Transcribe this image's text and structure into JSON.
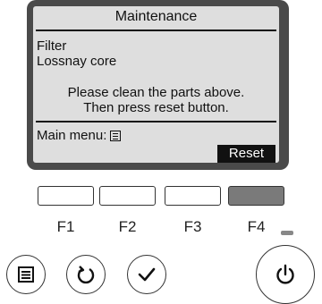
{
  "screen": {
    "title": "Maintenance",
    "items": [
      "Filter",
      "Lossnay core"
    ],
    "message": [
      "Please clean the parts above.",
      "Then press reset button."
    ],
    "main_menu_label": "Main menu:",
    "reset_label": "Reset"
  },
  "function_buttons": [
    {
      "label": "F1",
      "active": false
    },
    {
      "label": "F2",
      "active": false
    },
    {
      "label": "F3",
      "active": false
    },
    {
      "label": "F4",
      "active": true
    }
  ],
  "bottom_buttons": {
    "menu_icon": "menu-icon",
    "return_icon": "return-icon",
    "confirm_icon": "checkmark-icon",
    "power_icon": "power-icon"
  },
  "colors": {
    "lcd_background": "#dedede",
    "frame": "#4a4a4a",
    "active_button": "#7a7a7a"
  }
}
